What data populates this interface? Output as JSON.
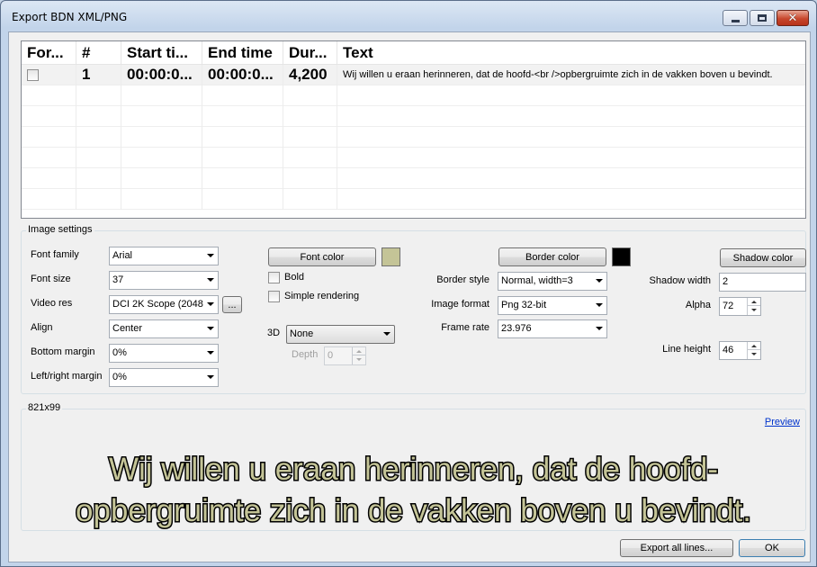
{
  "window": {
    "title": "Export BDN XML/PNG",
    "minimize_glyph": "",
    "close_glyph": "✕"
  },
  "grid": {
    "columns": [
      "For...",
      "#",
      "Start ti...",
      "End time",
      "Dur...",
      "Text"
    ],
    "rows": [
      {
        "forced": false,
        "number": "1",
        "start": "00:00:0...",
        "end": "00:00:0...",
        "duration": "4,200",
        "text": "Wij willen u eraan herinneren, dat de hoofd-<br />opbergruimte zich in de vakken boven u bevindt."
      }
    ]
  },
  "image_settings": {
    "group_label": "Image settings",
    "font_family": {
      "label": "Font family",
      "value": "Arial"
    },
    "font_size": {
      "label": "Font size",
      "value": "37"
    },
    "video_res": {
      "label": "Video res",
      "value": "DCI 2K Scope (2048",
      "browse_label": "..."
    },
    "align": {
      "label": "Align",
      "value": "Center"
    },
    "bottom_margin": {
      "label": "Bottom margin",
      "value": "0%"
    },
    "left_right_margin": {
      "label": "Left/right margin",
      "value": "0%"
    },
    "font_color": {
      "label": "Font color",
      "color": "#c4c497"
    },
    "bold": {
      "label": "Bold",
      "checked": false
    },
    "simple_rendering": {
      "label": "Simple rendering",
      "checked": false
    },
    "three_d": {
      "label": "3D",
      "value": "None"
    },
    "depth": {
      "label": "Depth",
      "value": "0"
    },
    "border_color": {
      "label": "Border color",
      "color": "#000000"
    },
    "border_style": {
      "label": "Border style",
      "value": "Normal, width=3"
    },
    "image_format": {
      "label": "Image format",
      "value": "Png 32-bit"
    },
    "frame_rate": {
      "label": "Frame rate",
      "value": "23.976"
    },
    "shadow_color": {
      "label": "Shadow color"
    },
    "shadow_width": {
      "label": "Shadow width",
      "value": "2"
    },
    "alpha": {
      "label": "Alpha",
      "value": "72"
    },
    "line_height": {
      "label": "Line height",
      "value": "46"
    }
  },
  "preview": {
    "size_label": "821x99",
    "link_label": "Preview",
    "lines": [
      "Wij willen u eraan herinneren, dat de hoofd-",
      "opbergruimte zich in de vakken boven u bevindt."
    ]
  },
  "footer": {
    "export_all_label": "Export all lines...",
    "ok_label": "OK"
  },
  "colors": {
    "accent": "#3399ff",
    "link": "#0033cc"
  }
}
